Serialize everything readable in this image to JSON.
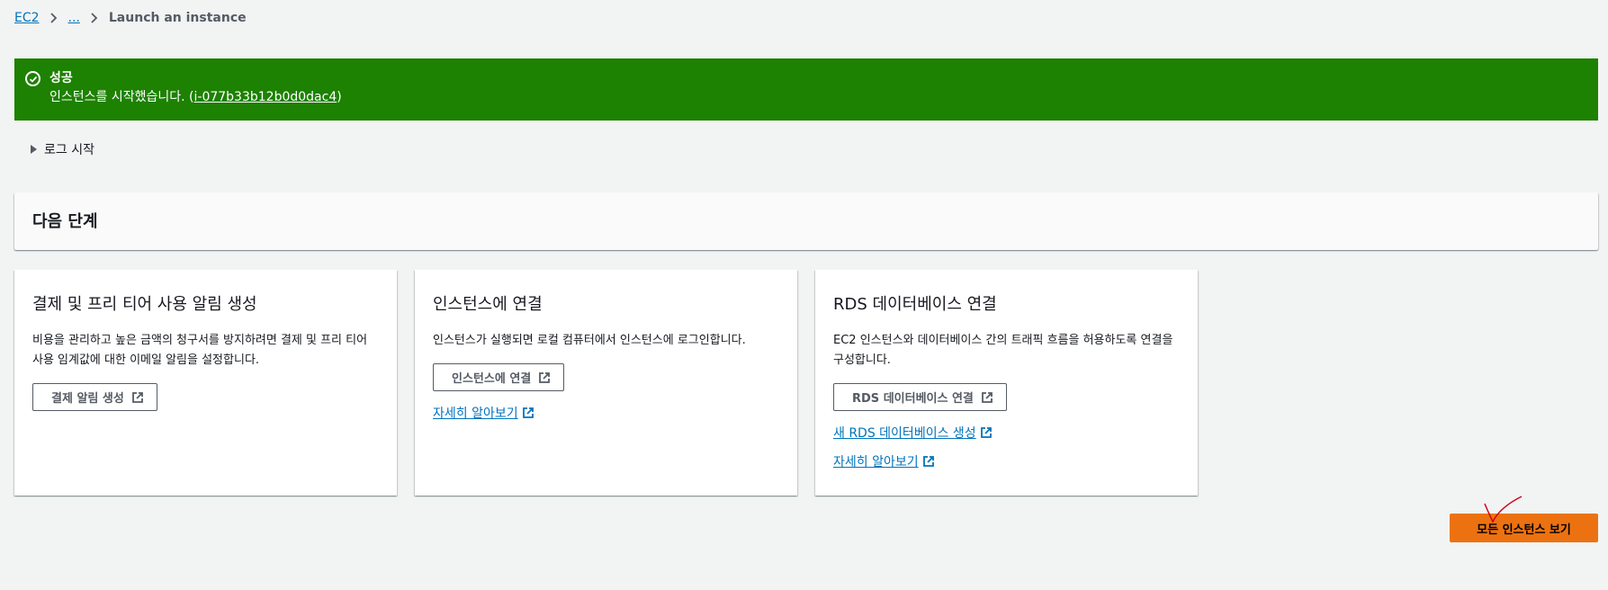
{
  "breadcrumb": {
    "root": "EC2",
    "ellipsis": "...",
    "current": "Launch an instance"
  },
  "flash": {
    "title": "성공",
    "message": "인스턴스를 시작했습니다. (",
    "instance_id": "i-077b33b12b0d0dac4",
    "message_end": ")",
    "color": "#1d8102"
  },
  "log": {
    "label": "로그 시작"
  },
  "next_steps": {
    "title": "다음 단계"
  },
  "cards": [
    {
      "title": "결제 및 프리 티어 사용 알림 생성",
      "desc": "비용을 관리하고 높은 금액의 청구서를 방지하려면 결제 및 프리 티어 사용 임계값에 대한 이메일 알림을 설정합니다.",
      "button": "결제 알림 생성"
    },
    {
      "title": "인스턴스에 연결",
      "desc": "인스턴스가 실행되면 로컬 컴퓨터에서 인스턴스에 로그인합니다.",
      "button": "인스턴스에 연결",
      "link1": "자세히 알아보기"
    },
    {
      "title": "RDS 데이터베이스 연결",
      "desc": "EC2 인스턴스와 데이터베이스 간의 트래픽 흐름을 허용하도록 연결을 구성합니다.",
      "button": "RDS 데이터베이스 연결",
      "link1": "새 RDS 데이터베이스 생성",
      "link2": "자세히 알아보기"
    }
  ],
  "primary_button": {
    "label": "모든 인스턴스 보기",
    "color": "#ec7211"
  }
}
